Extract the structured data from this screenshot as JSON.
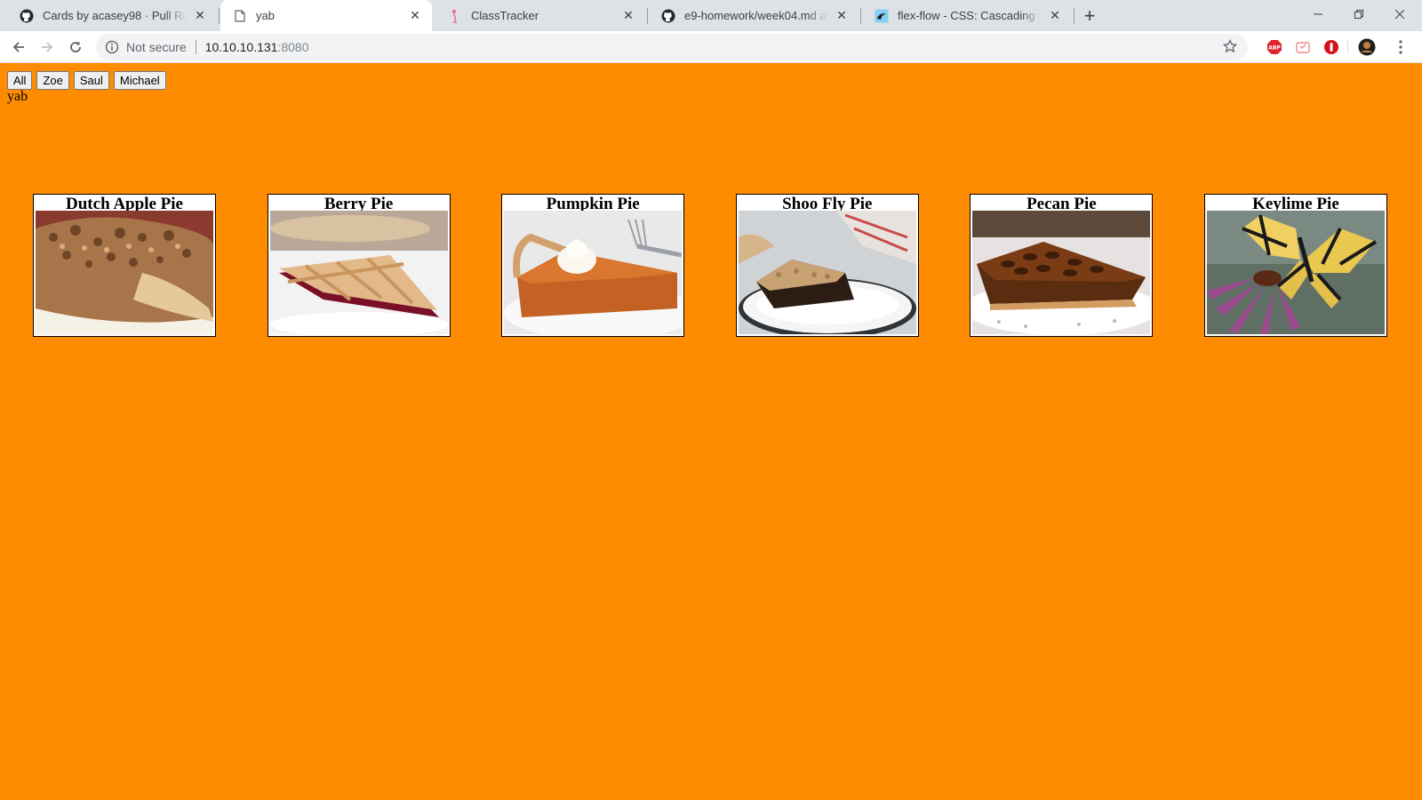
{
  "browser": {
    "tabs": [
      {
        "title": "Cards by acasey98 · Pull Request",
        "icon": "github-icon",
        "active": false
      },
      {
        "title": "yab",
        "icon": "page-icon",
        "active": true
      },
      {
        "title": "ClassTracker",
        "icon": "flamingo-icon",
        "active": false
      },
      {
        "title": "e9-homework/week04.md at ma",
        "icon": "github-icon",
        "active": false
      },
      {
        "title": "flex-flow - CSS: Cascading Style S",
        "icon": "mdn-icon",
        "active": false
      }
    ],
    "new_tab_label": "+",
    "security_text": "Not secure",
    "url_host": "10.10.10.131",
    "url_port": ":8080",
    "extensions": [
      "abp-icon",
      "extension-icon",
      "privacy-badger-icon",
      "profile-avatar"
    ]
  },
  "page": {
    "filters": [
      "All",
      "Zoe",
      "Saul",
      "Michael"
    ],
    "label": "yab",
    "cards": [
      {
        "title": "Dutch Apple Pie",
        "image": "dutch-apple-pie-photo"
      },
      {
        "title": "Berry Pie",
        "image": "berry-pie-photo"
      },
      {
        "title": "Pumpkin Pie",
        "image": "pumpkin-pie-photo"
      },
      {
        "title": "Shoo Fly Pie",
        "image": "shoo-fly-pie-photo"
      },
      {
        "title": "Pecan Pie",
        "image": "pecan-pie-photo"
      },
      {
        "title": "Keylime Pie",
        "image": "butterfly-photo"
      }
    ]
  },
  "colors": {
    "page_background": "#ff8c00",
    "tabstrip": "#dee1e6"
  }
}
